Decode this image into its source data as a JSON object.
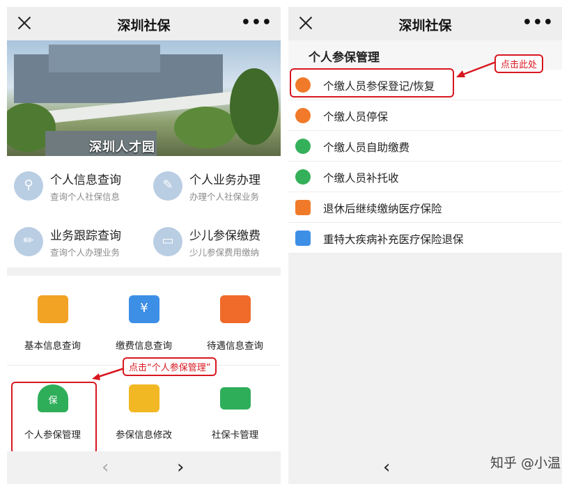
{
  "left": {
    "title": "深圳社保",
    "banner_sign": "深圳人才园",
    "info_items": [
      {
        "title": "个人信息查询",
        "sub": "查询个人社保信息",
        "icon": "search-icon"
      },
      {
        "title": "个人业务办理",
        "sub": "办理个人社保业务",
        "icon": "document-edit-icon"
      },
      {
        "title": "业务跟踪查询",
        "sub": "查询个人办理业务",
        "icon": "pencil-icon"
      },
      {
        "title": "少儿参保缴费",
        "sub": "少儿参保费用缴纳",
        "icon": "monitor-icon"
      }
    ],
    "grid_items": [
      {
        "label": "基本信息查询",
        "icon": "id-card-icon",
        "color": "#f2a324"
      },
      {
        "label": "缴费信息查询",
        "icon": "yen-card-icon",
        "color": "#3d8fe6"
      },
      {
        "label": "待遇信息查询",
        "icon": "checklist-icon",
        "color": "#f06a2a"
      },
      {
        "label": "个人参保管理",
        "icon": "insured-person-icon",
        "color": "#2fae5a"
      },
      {
        "label": "参保信息修改",
        "icon": "edit-form-icon",
        "color": "#f2b824"
      },
      {
        "label": "社保卡管理",
        "icon": "social-card-icon",
        "color": "#2fae5a"
      }
    ],
    "callout": "点击“个人参保管理”",
    "nav_prev": "‹",
    "nav_next": "›"
  },
  "right": {
    "title": "深圳社保",
    "section_title": "个人参保管理",
    "items": [
      {
        "label": "个缴人员参保登记/恢复",
        "icon": "money-bag-icon",
        "color": "#f07a2a"
      },
      {
        "label": "个缴人员停保",
        "icon": "pause-coin-icon",
        "color": "#f07a2a"
      },
      {
        "label": "个缴人员自助缴费",
        "icon": "coin-clock-icon",
        "color": "#35b05a"
      },
      {
        "label": "个缴人员补托收",
        "icon": "coin-clock-icon",
        "color": "#35b05a"
      },
      {
        "label": "退休后继续缴纳医疗保险",
        "icon": "medical-kit-icon",
        "color": "#f07a2a"
      },
      {
        "label": "重特大疾病补充医疗保险退保",
        "icon": "hand-document-icon",
        "color": "#3d8fe6"
      }
    ],
    "callout": "点击此处",
    "nav_prev": "‹",
    "watermark": "知乎 @小温"
  }
}
